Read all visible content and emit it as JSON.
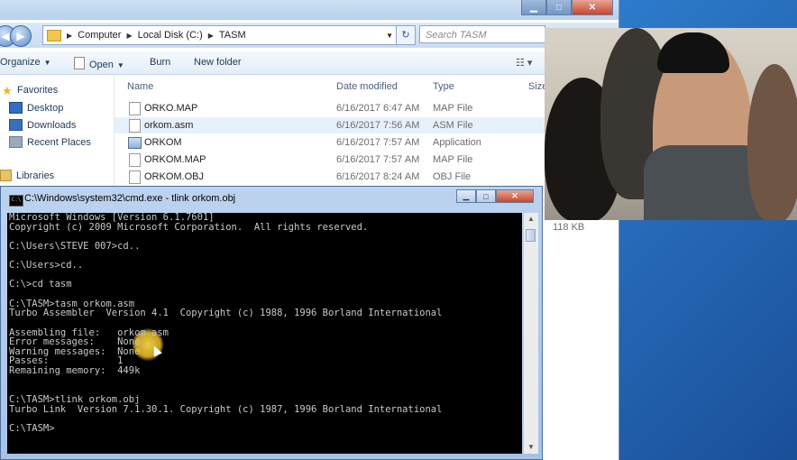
{
  "explorer": {
    "address": {
      "crumbs": [
        "Computer",
        "Local Disk (C:)",
        "TASM"
      ],
      "search_placeholder": "Search TASM"
    },
    "toolbar": {
      "organize": "Organize",
      "open": "Open",
      "burn": "Burn",
      "new_folder": "New folder"
    },
    "sidebar": {
      "favorites": "Favorites",
      "desktop": "Desktop",
      "downloads": "Downloads",
      "recent": "Recent Places",
      "libraries": "Libraries"
    },
    "columns": {
      "name": "Name",
      "date": "Date modified",
      "type": "Type",
      "size": "Size"
    },
    "files": [
      {
        "name": "ORKO.MAP",
        "date": "6/16/2017 6:47 AM",
        "type": "MAP File"
      },
      {
        "name": "orkom.asm",
        "date": "6/16/2017 7:56 AM",
        "type": "ASM File"
      },
      {
        "name": "ORKOM",
        "date": "6/16/2017 7:57 AM",
        "type": "Application"
      },
      {
        "name": "ORKOM.MAP",
        "date": "6/16/2017 7:57 AM",
        "type": "MAP File"
      },
      {
        "name": "ORKOM.OBJ",
        "date": "6/16/2017 8:24 AM",
        "type": "OBJ File"
      }
    ],
    "size_partial": "118 KB"
  },
  "cmd": {
    "title": "C:\\Windows\\system32\\cmd.exe - tlink  orkom.obj",
    "lines": [
      "Microsoft Windows [Version 6.1.7601]",
      "Copyright (c) 2009 Microsoft Corporation.  All rights reserved.",
      "",
      "C:\\Users\\STEVE 007>cd..",
      "",
      "C:\\Users>cd..",
      "",
      "C:\\>cd tasm",
      "",
      "C:\\TASM>tasm orkom.asm",
      "Turbo Assembler  Version 4.1  Copyright (c) 1988, 1996 Borland International",
      "",
      "Assembling file:   orkom.asm",
      "Error messages:    None",
      "Warning messages:  None",
      "Passes:            1",
      "Remaining memory:  449k",
      "",
      "",
      "C:\\TASM>tlink orkom.obj",
      "Turbo Link  Version 7.1.30.1. Copyright (c) 1987, 1996 Borland International",
      "",
      "C:\\TASM>"
    ]
  },
  "colors": {
    "console_bg": "#000000",
    "console_text": "#c8c8c8",
    "highlight": "#e3c23a"
  }
}
